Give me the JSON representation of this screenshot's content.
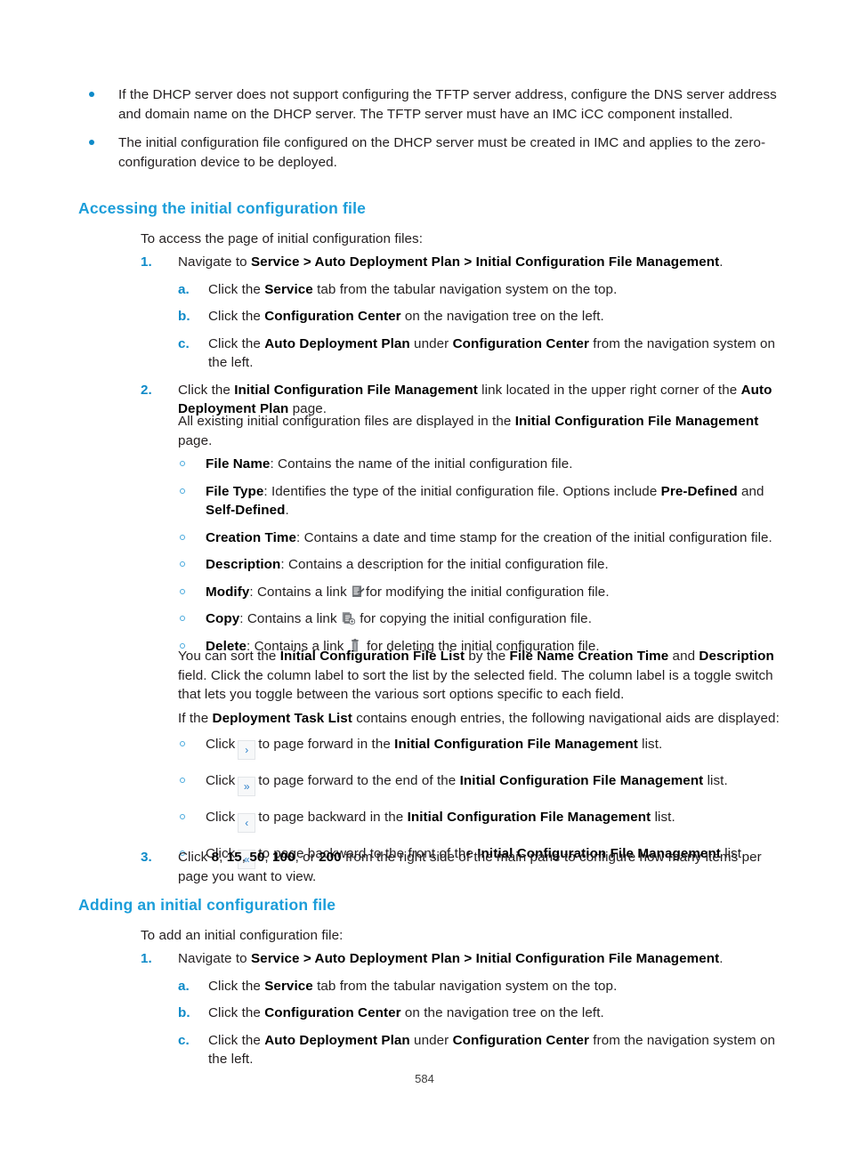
{
  "page": {
    "folio": "584"
  },
  "intro_bullets": [
    {
      "parts": [
        {
          "t": "If the DHCP server does not support configuring the TFTP server address, configure the DNS server address and domain name on the DHCP server. The TFTP server must have an IMC iCC component installed.",
          "b": false
        }
      ]
    },
    {
      "parts": [
        {
          "t": "The initial configuration file configured on the DHCP server must be created in IMC and applies to the zero-configuration device to be deployed.",
          "b": false
        }
      ]
    }
  ],
  "section_accessing": {
    "heading": "Accessing the initial configuration file",
    "lead": "To access the page of initial configuration files:",
    "step1": {
      "marker": "1.",
      "parts": [
        {
          "t": "Navigate to ",
          "b": false
        },
        {
          "t": "Service > Auto Deployment Plan > Initial Configuration File Management",
          "b": true
        },
        {
          "t": ".",
          "b": false
        }
      ],
      "substeps": [
        {
          "marker": "a.",
          "parts": [
            {
              "t": "Click the ",
              "b": false
            },
            {
              "t": "Service",
              "b": true
            },
            {
              "t": " tab from the tabular navigation system on the top.",
              "b": false
            }
          ]
        },
        {
          "marker": "b.",
          "parts": [
            {
              "t": "Click the ",
              "b": false
            },
            {
              "t": "Configuration Center",
              "b": true
            },
            {
              "t": " on the navigation tree on the left.",
              "b": false
            }
          ]
        },
        {
          "marker": "c.",
          "parts": [
            {
              "t": "Click the ",
              "b": false
            },
            {
              "t": "Auto Deployment Plan",
              "b": true
            },
            {
              "t": " under ",
              "b": false
            },
            {
              "t": "Configuration Center",
              "b": true
            },
            {
              "t": " from the navigation system on the left.",
              "b": false
            }
          ]
        }
      ]
    },
    "step2": {
      "marker": "2.",
      "parts": [
        {
          "t": "Click the ",
          "b": false
        },
        {
          "t": "Initial Configuration File Management",
          "b": true
        },
        {
          "t": " link located in the upper right corner of the ",
          "b": false
        },
        {
          "t": "Auto Deployment Plan",
          "b": true
        },
        {
          "t": " page.",
          "b": false
        }
      ]
    },
    "displayed_para": {
      "parts": [
        {
          "t": "All existing initial configuration files are displayed in the ",
          "b": false
        },
        {
          "t": "Initial Configuration File Management",
          "b": true
        },
        {
          "t": " page.",
          "b": false
        }
      ]
    },
    "field_list": [
      {
        "parts": [
          {
            "t": "File Name",
            "b": true
          },
          {
            "t": ": Contains the name of the initial configuration file.",
            "b": false
          }
        ]
      },
      {
        "parts": [
          {
            "t": "File Type",
            "b": true
          },
          {
            "t": ": Identifies the type of the initial configuration file. Options include ",
            "b": false
          },
          {
            "t": "Pre-Defined",
            "b": true
          },
          {
            "t": " and ",
            "b": false
          },
          {
            "t": "Self-Defined",
            "b": true
          },
          {
            "t": ".",
            "b": false
          }
        ]
      },
      {
        "parts": [
          {
            "t": "Creation Time",
            "b": true
          },
          {
            "t": ": Contains a date and time stamp for the creation of the initial configuration file.",
            "b": false
          }
        ]
      },
      {
        "parts": [
          {
            "t": "Description",
            "b": true
          },
          {
            "t": ": Contains a description for the initial configuration file.",
            "b": false
          }
        ]
      },
      {
        "icon": "modify-icon",
        "parts": [
          {
            "t": "Modify",
            "b": true
          },
          {
            "t": ": Contains a link ",
            "b": false
          }
        ],
        "parts_after": [
          {
            "t": "for modifying the initial configuration file.",
            "b": false
          }
        ]
      },
      {
        "icon": "copy-icon",
        "parts": [
          {
            "t": "Copy",
            "b": true
          },
          {
            "t": ": Contains a link ",
            "b": false
          }
        ],
        "parts_after": [
          {
            "t": " for copying the initial configuration file.",
            "b": false
          }
        ]
      },
      {
        "icon": "delete-icon",
        "parts": [
          {
            "t": "Delete",
            "b": true
          },
          {
            "t": ": Contains a link ",
            "b": false
          }
        ],
        "parts_after": [
          {
            "t": " for deleting the initial configuration file.",
            "b": false
          }
        ]
      }
    ],
    "sort_para": {
      "parts": [
        {
          "t": "You can sort the ",
          "b": false
        },
        {
          "t": "Initial Configuration File List",
          "b": true
        },
        {
          "t": " by the ",
          "b": false
        },
        {
          "t": "File Name Creation Time",
          "b": true
        },
        {
          "t": " and ",
          "b": false
        },
        {
          "t": "Description",
          "b": true
        },
        {
          "t": " field. Click the column label to sort the list by the selected field. The column label is a toggle switch that lets you toggle between the various sort options specific to each field.",
          "b": false
        }
      ]
    },
    "nav_aids_para": {
      "parts": [
        {
          "t": "If the ",
          "b": false
        },
        {
          "t": "Deployment Task List",
          "b": true
        },
        {
          "t": " contains enough entries, the following navigational aids are displayed:",
          "b": false
        }
      ]
    },
    "nav_aids": [
      {
        "click_label": "Click",
        "button_glyph": "›",
        "button_name": "page-forward-button",
        "parts": [
          {
            "t": "to page forward in the ",
            "b": false
          },
          {
            "t": "Initial Configuration File Management",
            "b": true
          },
          {
            "t": " list.",
            "b": false
          }
        ]
      },
      {
        "click_label": "Click",
        "button_glyph": "»",
        "button_name": "page-last-button",
        "parts": [
          {
            "t": "to page forward to the end of the ",
            "b": false
          },
          {
            "t": "Initial Configuration File Management",
            "b": true
          },
          {
            "t": " list.",
            "b": false
          }
        ]
      },
      {
        "click_label": "Click",
        "button_glyph": "‹",
        "button_name": "page-backward-button",
        "parts": [
          {
            "t": "to page backward in the ",
            "b": false
          },
          {
            "t": "Initial Configuration File Management",
            "b": true
          },
          {
            "t": " list.",
            "b": false
          }
        ]
      },
      {
        "click_label": "Click",
        "button_glyph": "«",
        "button_name": "page-first-button",
        "parts": [
          {
            "t": "to page backward to the front of the ",
            "b": false
          },
          {
            "t": "Initial Configuration File Management",
            "b": true
          },
          {
            "t": " list.",
            "b": false
          }
        ]
      }
    ],
    "step3": {
      "marker": "3.",
      "parts": [
        {
          "t": "Click ",
          "b": false
        },
        {
          "t": "8",
          "b": true
        },
        {
          "t": ", ",
          "b": false
        },
        {
          "t": "15",
          "b": true
        },
        {
          "t": ", ",
          "b": false
        },
        {
          "t": "50",
          "b": true
        },
        {
          "t": ", ",
          "b": false
        },
        {
          "t": "100",
          "b": true
        },
        {
          "t": ", or ",
          "b": false
        },
        {
          "t": "200",
          "b": true
        },
        {
          "t": " from the right side of the main pane to configure how many items per page you want to view.",
          "b": false
        }
      ]
    }
  },
  "section_adding": {
    "heading": "Adding an initial configuration file",
    "lead": "To add an initial configuration file:",
    "step1": {
      "marker": "1.",
      "parts": [
        {
          "t": "Navigate to ",
          "b": false
        },
        {
          "t": "Service > Auto Deployment Plan > Initial Configuration File Management",
          "b": true
        },
        {
          "t": ".",
          "b": false
        }
      ],
      "substeps": [
        {
          "marker": "a.",
          "parts": [
            {
              "t": "Click the ",
              "b": false
            },
            {
              "t": "Service",
              "b": true
            },
            {
              "t": " tab from the tabular navigation system on the top.",
              "b": false
            }
          ]
        },
        {
          "marker": "b.",
          "parts": [
            {
              "t": "Click the ",
              "b": false
            },
            {
              "t": "Configuration Center",
              "b": true
            },
            {
              "t": " on the navigation tree on the left.",
              "b": false
            }
          ]
        },
        {
          "marker": "c.",
          "parts": [
            {
              "t": "Click the ",
              "b": false
            },
            {
              "t": "Auto Deployment Plan",
              "b": true
            },
            {
              "t": " under ",
              "b": false
            },
            {
              "t": "Configuration Center",
              "b": true
            },
            {
              "t": " from the navigation system on the left.",
              "b": false
            }
          ]
        }
      ]
    }
  },
  "colors": {
    "heading_blue": "#1b9dd9",
    "marker_blue": "#0e8ac8",
    "circle_blue": "#49a9dd",
    "body_ink": "#231f20",
    "pager_glyph": "#2a7fc9"
  }
}
